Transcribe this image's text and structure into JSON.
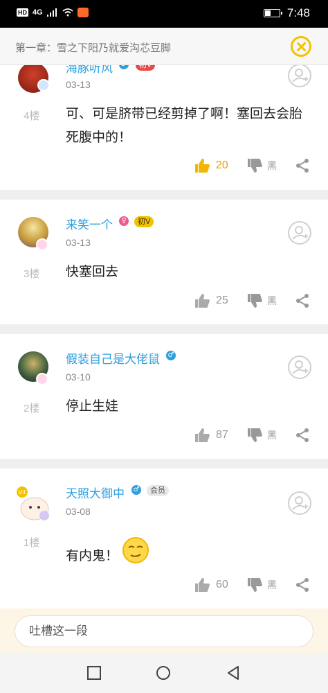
{
  "status_bar": {
    "hd": "HD",
    "network": "4G",
    "time": "7:48",
    "battery_level": 0.4
  },
  "header": {
    "chapter_title": "第一章：雪之下阳乃就爱沟芯豆脚",
    "close_icon": "close-circle-icon",
    "accent_color": "#f2c200"
  },
  "comments": [
    {
      "username": "海豚听风",
      "tag": "初V",
      "date": "03-13",
      "floor": "4楼",
      "content_lines": [
        "可、可是脐带已经剪掉了啊！塞回去会胎",
        "死腹中的！"
      ],
      "likes": "20",
      "liked": true,
      "dislike_label": "黑"
    },
    {
      "username": "来笑一个",
      "tag": "初V",
      "date": "03-13",
      "floor": "3楼",
      "content_lines": [
        "快塞回去"
      ],
      "likes": "25",
      "liked": false,
      "dislike_label": "黑"
    },
    {
      "username": "假装自己是大佬鼠",
      "date": "03-10",
      "floor": "2楼",
      "content_lines": [
        "停止生娃"
      ],
      "likes": "87",
      "liked": false,
      "dislike_label": "黑"
    },
    {
      "username": "天照大御中",
      "tag": "会员",
      "date": "03-08",
      "floor": "1楼",
      "content_lines": [
        "有内鬼！"
      ],
      "likes": "60",
      "liked": false,
      "dislike_label": "黑"
    }
  ],
  "input": {
    "placeholder": "吐槽这一段"
  },
  "colors": {
    "username": "#2d9fe0",
    "liked": "#e6a000",
    "tag_gold": "#f2c200"
  }
}
